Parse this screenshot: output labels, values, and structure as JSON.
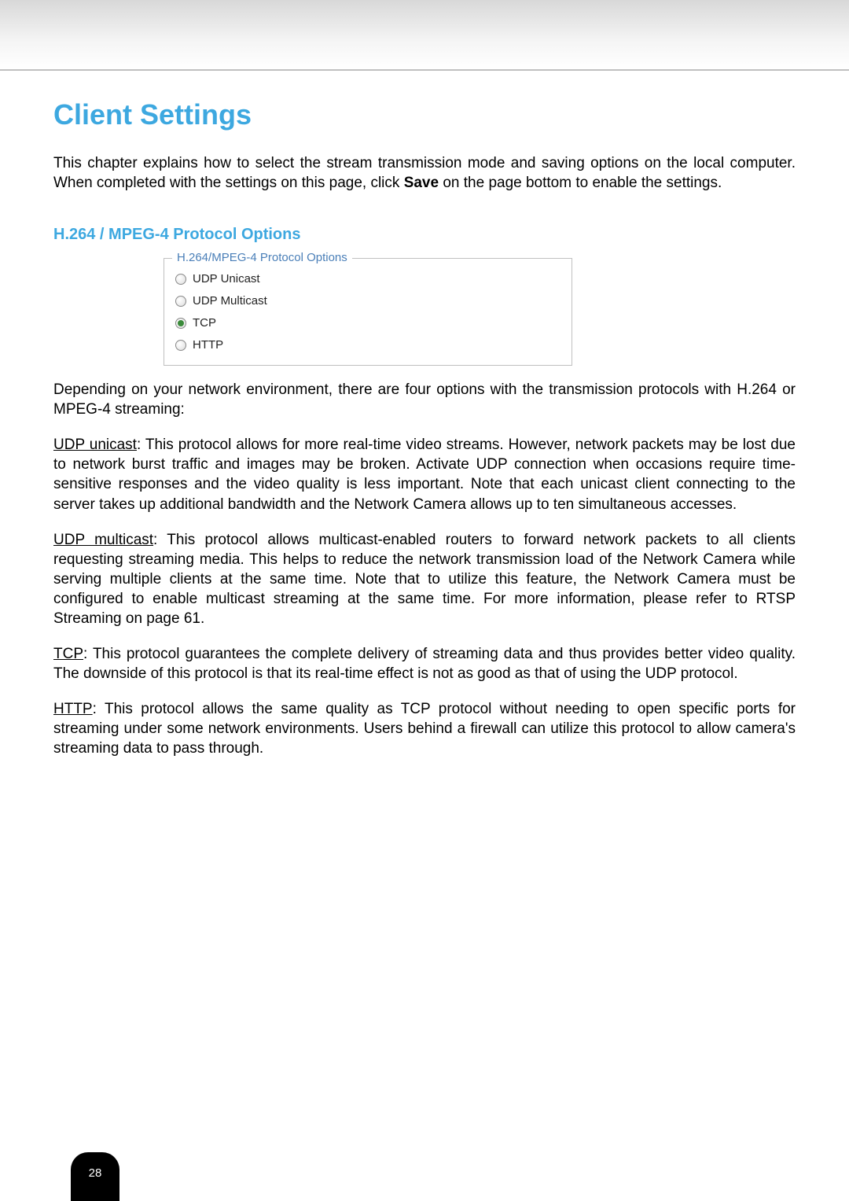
{
  "title": "Client Settings",
  "intro_part1": "This chapter explains how to select the stream transmission mode and saving options on the local computer. When completed with the settings on this page, click ",
  "intro_bold": "Save",
  "intro_part2": " on the page bottom to enable the settings.",
  "section_heading": "H.264 / MPEG-4 Protocol Options",
  "fieldset_legend": "H.264/MPEG-4 Protocol Options",
  "radios": {
    "udp_unicast": "UDP Unicast",
    "udp_multicast": "UDP Multicast",
    "tcp": "TCP",
    "http": "HTTP"
  },
  "selected_radio": "tcp",
  "para_depending": "Depending on your network environment, there are four options with the transmission protocols with H.264 or MPEG-4 streaming:",
  "udp_unicast_label": "UDP unicast",
  "udp_unicast_text": ": This protocol allows for more real-time video streams. However, network packets may be lost due to network burst traffic and images may be broken. Activate UDP connection when occasions require time-sensitive responses and the video quality is less important. Note that each unicast client connecting to the server takes up additional bandwidth and the Network Camera allows up to ten simultaneous accesses.",
  "udp_multicast_label": "UDP multicast",
  "udp_multicast_text": ": This protocol allows multicast-enabled routers to forward network packets to all clients requesting streaming media. This helps to reduce the network transmission load of the Network Camera while serving multiple clients at the same time. Note that to utilize this feature, the Network Camera must be configured to enable multicast streaming at the same time. For more information, please refer to RTSP Streaming on page 61.",
  "tcp_label": "TCP",
  "tcp_text": ": This protocol guarantees the complete delivery of streaming data and thus provides better video quality. The downside of this protocol is that its real-time effect is not as good as that of using the UDP protocol.",
  "http_label": "HTTP",
  "http_text": ": This protocol allows the same quality as TCP protocol without needing to open specific ports for streaming under some network environments. Users behind a firewall can utilize this protocol to allow camera's streaming data to pass through.",
  "page_number": "28"
}
